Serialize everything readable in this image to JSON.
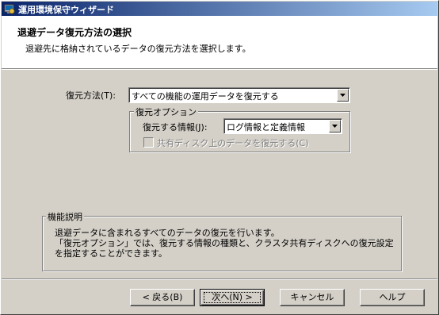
{
  "window": {
    "title": "運用環境保守ウィザード"
  },
  "header": {
    "title": "退避データ復元方法の選択",
    "subtitle": "退避先に格納されているデータの復元方法を選択します。"
  },
  "restore_method": {
    "label": "復元方法(T):",
    "value": "すべての機能の運用データを復元する"
  },
  "restore_options": {
    "group_title": "復元オプション",
    "info_label": "復元する情報(J):",
    "info_value": "ログ情報と定義情報",
    "shared_disk_label": "共有ディスク上のデータを復元する(C)",
    "shared_disk_checked": false,
    "shared_disk_enabled": false
  },
  "description": {
    "group_title": "機能説明",
    "line1": "退避データに含まれるすべてのデータの復元を行います。",
    "line2": "「復元オプション」では、復元する情報の種類と、クラスタ共有ディスクへの復元設定",
    "line3": "を指定することができます。"
  },
  "buttons": {
    "back": "< 戻る(B)",
    "next": "次へ(N) >",
    "cancel": "キャンセル",
    "help": "ヘルプ"
  }
}
